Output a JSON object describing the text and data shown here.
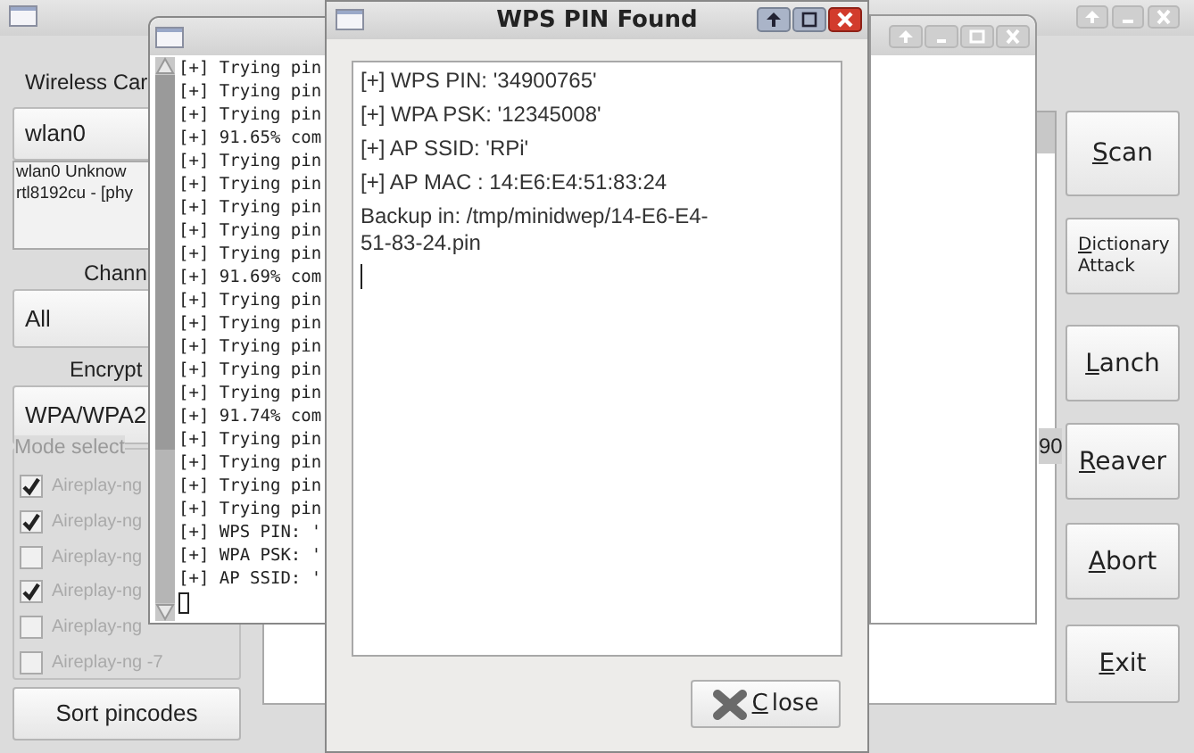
{
  "left_panel": {
    "wireless_label": "Wireless Car",
    "interface_combo": "wlan0",
    "interface_info": [
      "wlan0 Unknow",
      "rtl8192cu - [phy"
    ],
    "channel_label": "Chann",
    "channel_combo": "All",
    "encryption_label": "Encrypt",
    "encryption_combo": "WPA/WPA2",
    "mode_group": {
      "title": "Mode select",
      "disabled": true,
      "options": [
        {
          "label": "Aireplay-ng",
          "checked": true
        },
        {
          "label": "Aireplay-ng",
          "checked": true
        },
        {
          "label": "Aireplay-ng",
          "checked": false
        },
        {
          "label": "Aireplay-ng",
          "checked": true
        },
        {
          "label": "Aireplay-ng",
          "checked": false
        },
        {
          "label": "Aireplay-ng -7",
          "checked": false
        }
      ]
    },
    "sort_button": "Sort pincodes"
  },
  "network_list": {
    "cell": "90"
  },
  "side_buttons": [
    "Scan",
    "Dictionary Attack",
    "Lanch",
    "Reaver",
    "Abort",
    "Exit"
  ],
  "terminal": {
    "lines": [
      "[+] Trying pin",
      "[+] Trying pin",
      "[+] Trying pin",
      "[+] 91.65% com",
      "[+] Trying pin",
      "[+] Trying pin",
      "[+] Trying pin",
      "[+] Trying pin",
      "[+] Trying pin",
      "[+] 91.69% com",
      "[+] Trying pin",
      "[+] Trying pin",
      "[+] Trying pin",
      "[+] Trying pin",
      "[+] Trying pin",
      "[+] 91.74% com",
      "[+] Trying pin",
      "[+] Trying pin",
      "[+] Trying pin",
      "[+] Trying pin",
      "[+] WPS PIN: '",
      "[+] WPA PSK: '",
      "[+] AP SSID: '"
    ]
  },
  "dialog": {
    "title": "WPS PIN Found",
    "lines": [
      "[+] WPS PIN: '34900765'",
      "[+] WPA PSK: '12345008'",
      "[+] AP SSID: 'RPi'",
      "[+] AP MAC : 14:E6:E4:51:83:24",
      "Backup in: /tmp/minidwep/14-E6-E4-51-83-24.pin"
    ],
    "close_button": "Close"
  }
}
